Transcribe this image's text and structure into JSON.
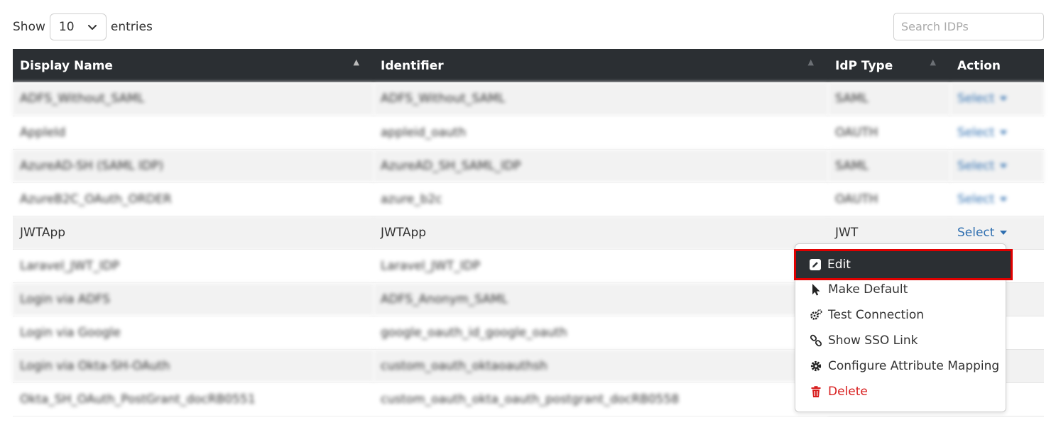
{
  "controls": {
    "show_label": "Show",
    "entries_value": "10",
    "entries_label": "entries",
    "search_placeholder": "Search IDPs"
  },
  "table": {
    "columns": [
      "Display Name",
      "Identifier",
      "IdP Type",
      "Action"
    ],
    "rows": [
      {
        "display_name": "ADFS_Without_SAML",
        "identifier": "ADFS_Without_SAML",
        "type": "SAML",
        "action": "Select",
        "blurred": true
      },
      {
        "display_name": "AppleId",
        "identifier": "appleid_oauth",
        "type": "OAUTH",
        "action": "Select",
        "blurred": true
      },
      {
        "display_name": "AzureAD-SH (SAML IDP)",
        "identifier": "AzureAD_SH_SAML_IDP",
        "type": "SAML",
        "action": "Select",
        "blurred": true
      },
      {
        "display_name": "AzureB2C_OAuth_ORDER",
        "identifier": "azure_b2c",
        "type": "OAUTH",
        "action": "Select",
        "blurred": true
      },
      {
        "display_name": "JWTApp",
        "identifier": "JWTApp",
        "type": "JWT",
        "action": "Select",
        "blurred": false
      },
      {
        "display_name": "Laravel_JWT_IDP",
        "identifier": "Laravel_JWT_IDP",
        "type": "",
        "action": "",
        "blurred": true
      },
      {
        "display_name": "Login via ADFS",
        "identifier": "ADFS_Anonym_SAML",
        "type": "",
        "action": "",
        "blurred": true
      },
      {
        "display_name": "Login via Google",
        "identifier": "google_oauth_id_google_oauth",
        "type": "",
        "action": "",
        "blurred": true
      },
      {
        "display_name": "Login via Okta-SH-OAuth",
        "identifier": "custom_oauth_oktaoauthsh",
        "type": "",
        "action": "",
        "blurred": true
      },
      {
        "display_name": "Okta_SH_OAuth_PostGrant_docRB0551",
        "identifier": "custom_oauth_okta_oauth_postgrant_docRB0558",
        "type": "",
        "action": "",
        "blurred": true
      }
    ]
  },
  "action_menu": {
    "items": [
      {
        "label": "Edit",
        "icon": "edit-icon"
      },
      {
        "label": "Make Default",
        "icon": "cursor-icon"
      },
      {
        "label": "Test Connection",
        "icon": "cogs-icon"
      },
      {
        "label": "Show SSO Link",
        "icon": "link-icon"
      },
      {
        "label": "Configure Attribute Mapping",
        "icon": "gear-icon"
      },
      {
        "label": "Delete",
        "icon": "trash-icon"
      }
    ]
  },
  "colors": {
    "header_bg": "#2b2f33",
    "link": "#2f6fb0",
    "highlight_outline": "#e00000",
    "danger": "#d81e1e"
  }
}
